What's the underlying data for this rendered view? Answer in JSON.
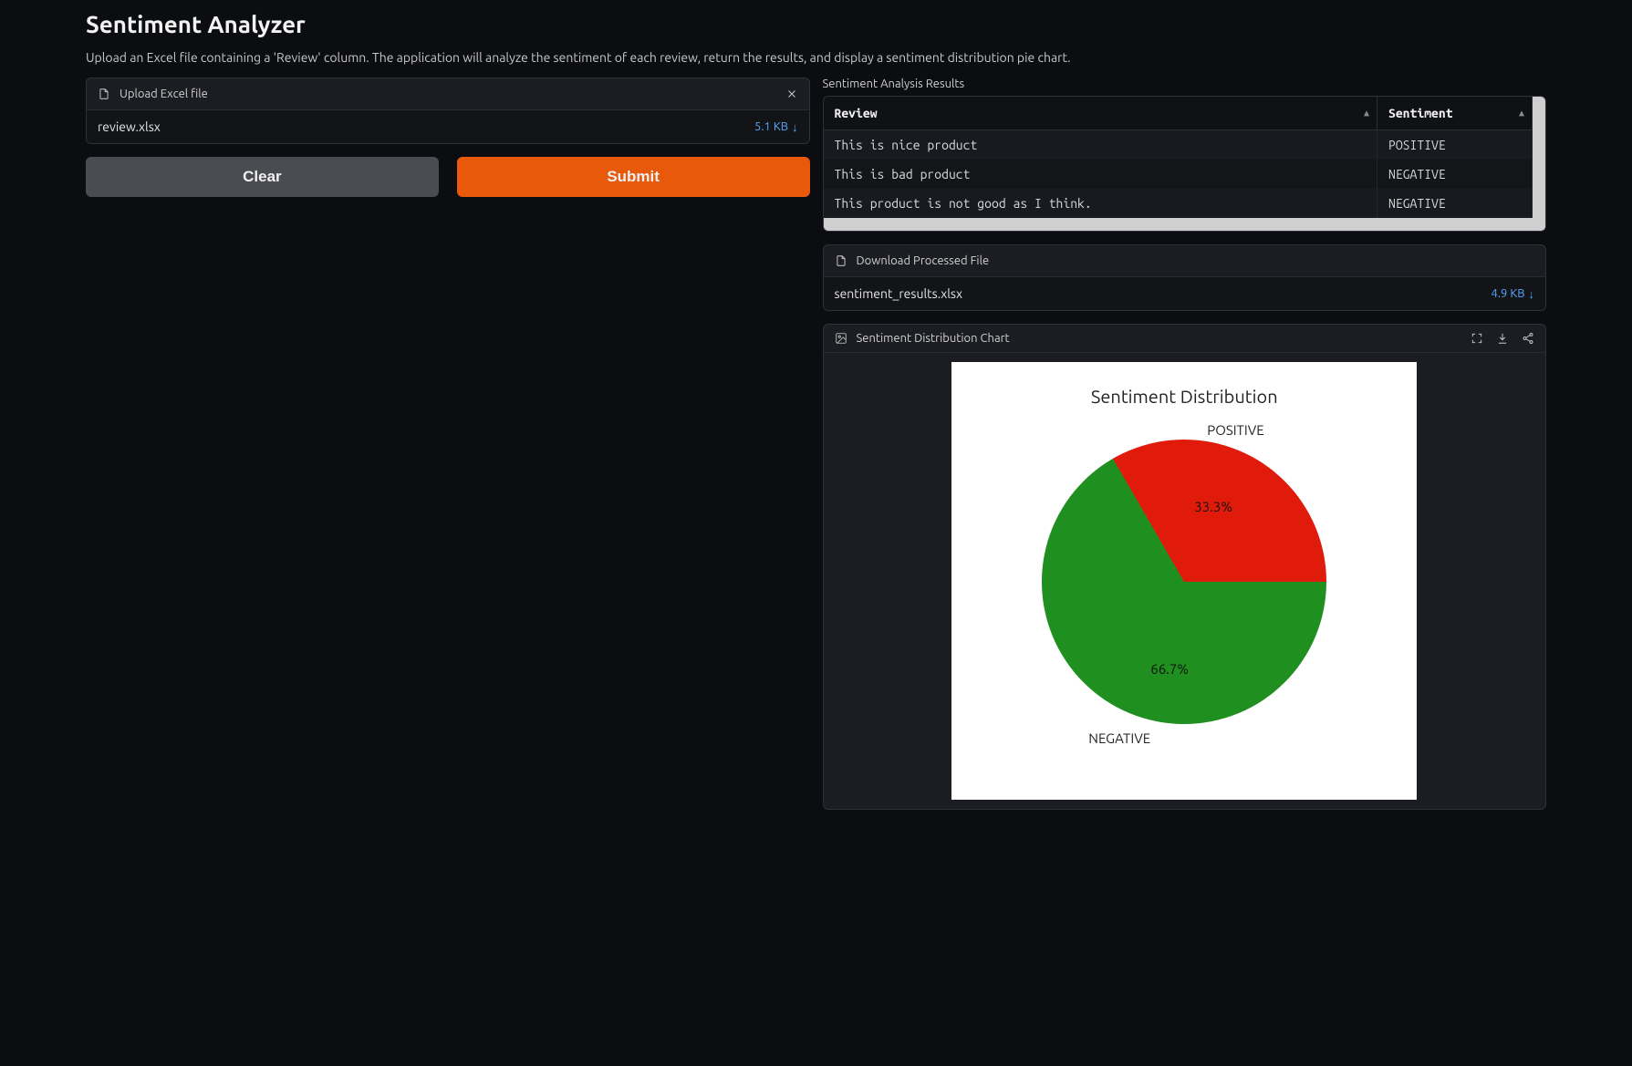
{
  "header": {
    "title": "Sentiment Analyzer",
    "subtitle": "Upload an Excel file containing a 'Review' column. The application will analyze the sentiment of each review, return the results, and display a sentiment distribution pie chart."
  },
  "upload": {
    "label": "Upload Excel file",
    "file_name": "review.xlsx",
    "file_size": "5.1 KB"
  },
  "buttons": {
    "clear": "Clear",
    "submit": "Submit"
  },
  "results": {
    "label": "Sentiment Analysis Results",
    "columns": [
      "Review",
      "Sentiment"
    ],
    "rows": [
      {
        "review": "This is nice product",
        "sentiment": "POSITIVE"
      },
      {
        "review": "This is bad product",
        "sentiment": "NEGATIVE"
      },
      {
        "review": "This product is not good as I think.",
        "sentiment": "NEGATIVE"
      }
    ]
  },
  "download": {
    "label": "Download Processed File",
    "file_name": "sentiment_results.xlsx",
    "file_size": "4.9 KB"
  },
  "chart": {
    "label": "Sentiment Distribution Chart"
  },
  "chart_data": {
    "type": "pie",
    "title": "Sentiment Distribution",
    "categories": [
      "POSITIVE",
      "NEGATIVE"
    ],
    "values": [
      33.3,
      66.7
    ],
    "value_labels": [
      "33.3%",
      "66.7%"
    ],
    "colors": [
      "#e01b0b",
      "#1f8f1f"
    ]
  }
}
